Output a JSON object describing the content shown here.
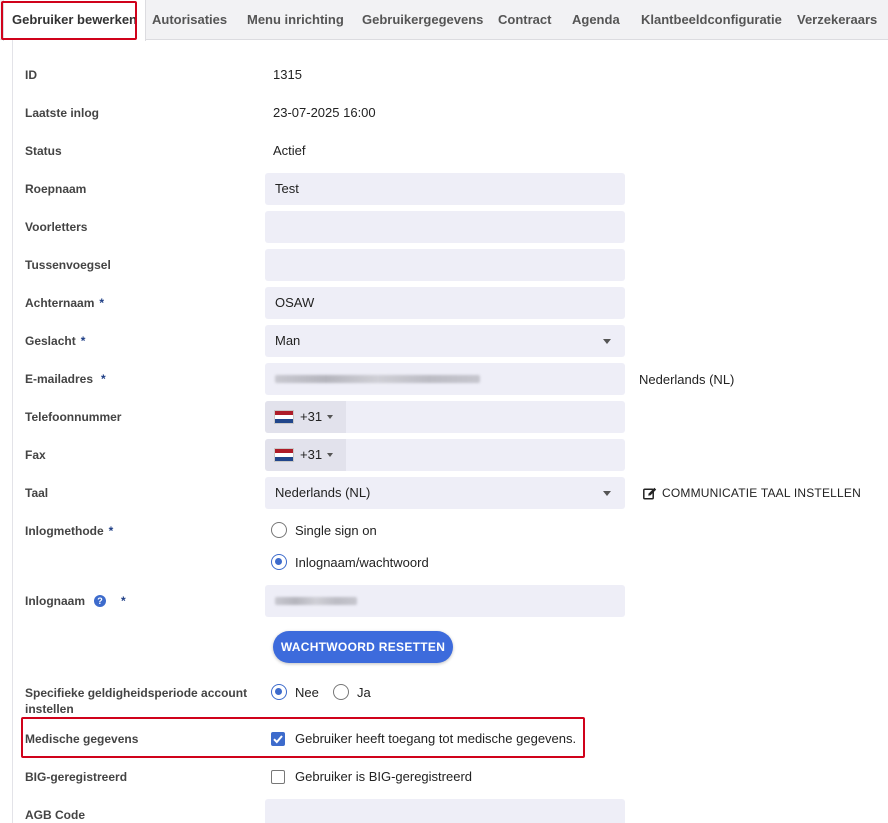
{
  "tabs": [
    {
      "label": "Gebruiker bewerken",
      "active": true
    },
    {
      "label": "Autorisaties"
    },
    {
      "label": "Menu inrichting"
    },
    {
      "label": "Gebruikergegevens"
    },
    {
      "label": "Contract"
    },
    {
      "label": "Agenda"
    },
    {
      "label": "Klantbeeldconfiguratie"
    },
    {
      "label": "Verzekeraars"
    }
  ],
  "form": {
    "id_label": "ID",
    "id_value": "1315",
    "last_login_label": "Laatste inlog",
    "last_login_value": "23-07-2025 16:00",
    "status_label": "Status",
    "status_value": "Actief",
    "roepnaam_label": "Roepnaam",
    "roepnaam_value": "Test",
    "voorletters_label": "Voorletters",
    "voorletters_value": "",
    "tussenvoegsel_label": "Tussenvoegsel",
    "tussenvoegsel_value": "",
    "achternaam_label": "Achternaam",
    "achternaam_value": "OSAW",
    "geslacht_label": "Geslacht",
    "geslacht_value": "Man",
    "email_label": "E-mailadres",
    "email_language": "Nederlands (NL)",
    "telefoon_label": "Telefoonnummer",
    "telefoon_prefix": "+31",
    "fax_label": "Fax",
    "fax_prefix": "+31",
    "taal_label": "Taal",
    "taal_value": "Nederlands (NL)",
    "communicatie_taal_link": "COMMUNICATIE TAAL INSTELLEN",
    "inlogmethode_label": "Inlogmethode",
    "inlogmethode_options": [
      "Single sign on",
      "Inlognaam/wachtwoord"
    ],
    "inlogmethode_selected": "Inlognaam/wachtwoord",
    "inlognaam_label": "Inlognaam",
    "reset_button": "WACHTWOORD RESETTEN",
    "geldigheid_label_line1": "Specifieke geldigheidsperiode account",
    "geldigheid_label_line2": "instellen",
    "geldigheid_options": [
      "Nee",
      "Ja"
    ],
    "geldigheid_selected": "Nee",
    "medische_label": "Medische gegevens",
    "medische_checkbox": "Gebruiker heeft toegang tot medische gegevens.",
    "medische_checked": true,
    "big_label": "BIG-geregistreerd",
    "big_checkbox": "Gebruiker is BIG-geregistreerd",
    "big_checked": false,
    "agb_label": "AGB Code",
    "required_marker": "*",
    "help_glyph": "?"
  },
  "colors": {
    "accent": "#3d6bdc",
    "highlight_box": "#d0021b",
    "field_bg": "#eeeef7"
  }
}
